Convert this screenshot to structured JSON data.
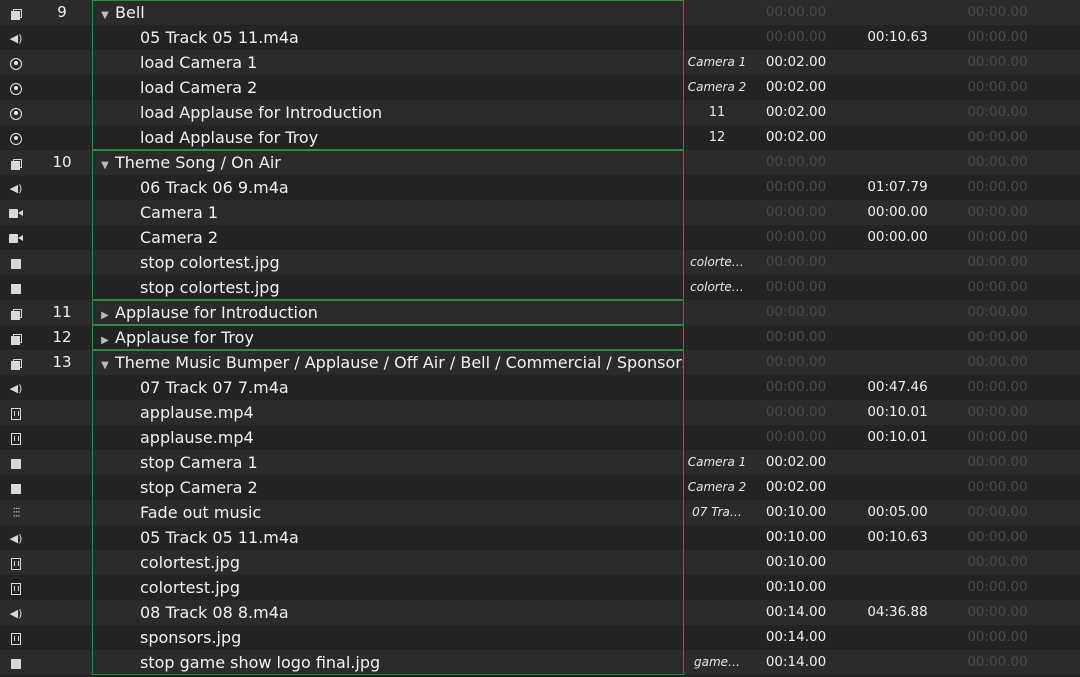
{
  "rows": [
    {
      "icon": "group",
      "icon_name": "group-cue-icon",
      "num": "9",
      "name": "Bell",
      "kind": "group",
      "expand": "open",
      "target": "",
      "pre": "00:00.00",
      "pre_lit": false,
      "dur": "",
      "dur_lit": false,
      "post": "00:00.00",
      "post_lit": false
    },
    {
      "icon": "audio",
      "icon_name": "audio-cue-icon",
      "num": "",
      "name": "05 Track 05 11.m4a",
      "kind": "child",
      "target": "",
      "pre": "00:00.00",
      "pre_lit": false,
      "dur": "00:10.63",
      "dur_lit": true,
      "post": "00:00.00",
      "post_lit": false
    },
    {
      "icon": "target",
      "icon_name": "load-cue-icon",
      "num": "",
      "name": "load Camera 1",
      "kind": "child",
      "target": "Camera 1",
      "pre": "00:02.00",
      "pre_lit": true,
      "dur": "",
      "dur_lit": false,
      "post": "00:00.00",
      "post_lit": false
    },
    {
      "icon": "target",
      "icon_name": "load-cue-icon",
      "num": "",
      "name": "load Camera 2",
      "kind": "child",
      "target": "Camera 2",
      "pre": "00:02.00",
      "pre_lit": true,
      "dur": "",
      "dur_lit": false,
      "post": "00:00.00",
      "post_lit": false
    },
    {
      "icon": "target",
      "icon_name": "load-cue-icon",
      "num": "",
      "name": "load Applause for Introduction",
      "kind": "child",
      "target": "11",
      "target_num": true,
      "pre": "00:02.00",
      "pre_lit": true,
      "dur": "",
      "dur_lit": false,
      "post": "00:00.00",
      "post_lit": false
    },
    {
      "icon": "target",
      "icon_name": "load-cue-icon",
      "num": "",
      "name": "load Applause for Troy",
      "kind": "child",
      "target": "12",
      "target_num": true,
      "pre": "00:02.00",
      "pre_lit": true,
      "dur": "",
      "dur_lit": false,
      "post": "00:00.00",
      "post_lit": false
    },
    {
      "icon": "group",
      "icon_name": "group-cue-icon",
      "num": "10",
      "name": "Theme Song / On Air",
      "kind": "group",
      "expand": "open",
      "target": "",
      "pre": "00:00.00",
      "pre_lit": false,
      "dur": "",
      "dur_lit": false,
      "post": "00:00.00",
      "post_lit": false
    },
    {
      "icon": "audio",
      "icon_name": "audio-cue-icon",
      "num": "",
      "name": "06 Track 06 9.m4a",
      "kind": "child",
      "target": "",
      "pre": "00:00.00",
      "pre_lit": false,
      "dur": "01:07.79",
      "dur_lit": true,
      "post": "00:00.00",
      "post_lit": false
    },
    {
      "icon": "camera",
      "icon_name": "camera-cue-icon",
      "num": "",
      "name": "Camera 1",
      "kind": "child",
      "target": "",
      "pre": "00:00.00",
      "pre_lit": false,
      "dur": "00:00.00",
      "dur_lit": true,
      "post": "00:00.00",
      "post_lit": false
    },
    {
      "icon": "camera",
      "icon_name": "camera-cue-icon",
      "num": "",
      "name": "Camera 2",
      "kind": "child",
      "target": "",
      "pre": "00:00.00",
      "pre_lit": false,
      "dur": "00:00.00",
      "dur_lit": true,
      "post": "00:00.00",
      "post_lit": false
    },
    {
      "icon": "stop",
      "icon_name": "stop-cue-icon",
      "num": "",
      "name": "stop colortest.jpg",
      "kind": "child",
      "target": "colorte…",
      "pre": "00:00.00",
      "pre_lit": false,
      "dur": "",
      "dur_lit": false,
      "post": "00:00.00",
      "post_lit": false
    },
    {
      "icon": "stop",
      "icon_name": "stop-cue-icon",
      "num": "",
      "name": "stop colortest.jpg",
      "kind": "child",
      "target": "colorte…",
      "pre": "00:00.00",
      "pre_lit": false,
      "dur": "",
      "dur_lit": false,
      "post": "00:00.00",
      "post_lit": false
    },
    {
      "icon": "group",
      "icon_name": "group-cue-icon",
      "num": "11",
      "name": "Applause for Introduction",
      "kind": "group",
      "expand": "closed",
      "target": "",
      "pre": "00:00.00",
      "pre_lit": false,
      "dur": "",
      "dur_lit": false,
      "post": "00:00.00",
      "post_lit": false
    },
    {
      "icon": "group",
      "icon_name": "group-cue-icon",
      "num": "12",
      "name": "Applause for Troy",
      "kind": "group",
      "expand": "closed",
      "target": "",
      "pre": "00:00.00",
      "pre_lit": false,
      "dur": "",
      "dur_lit": false,
      "post": "00:00.00",
      "post_lit": false
    },
    {
      "icon": "group",
      "icon_name": "group-cue-icon",
      "num": "13",
      "name": "Theme Music Bumper / Applause / Off Air / Bell / Commercial / Sponsors",
      "kind": "group",
      "expand": "open",
      "target": "",
      "pre": "00:00.00",
      "pre_lit": false,
      "dur": "",
      "dur_lit": false,
      "post": "00:00.00",
      "post_lit": false
    },
    {
      "icon": "audio",
      "icon_name": "audio-cue-icon",
      "num": "",
      "name": "07 Track 07 7.m4a",
      "kind": "child",
      "target": "",
      "pre": "00:00.00",
      "pre_lit": false,
      "dur": "00:47.46",
      "dur_lit": true,
      "post": "00:00.00",
      "post_lit": false
    },
    {
      "icon": "film",
      "icon_name": "video-cue-icon",
      "num": "",
      "name": "applause.mp4",
      "kind": "child",
      "target": "",
      "pre": "00:00.00",
      "pre_lit": false,
      "dur": "00:10.01",
      "dur_lit": true,
      "post": "00:00.00",
      "post_lit": false
    },
    {
      "icon": "film",
      "icon_name": "video-cue-icon",
      "num": "",
      "name": "applause.mp4",
      "kind": "child",
      "target": "",
      "pre": "00:00.00",
      "pre_lit": false,
      "dur": "00:10.01",
      "dur_lit": true,
      "post": "00:00.00",
      "post_lit": false
    },
    {
      "icon": "stop",
      "icon_name": "stop-cue-icon",
      "num": "",
      "name": "stop Camera 1",
      "kind": "child",
      "target": "Camera 1",
      "pre": "00:02.00",
      "pre_lit": true,
      "dur": "",
      "dur_lit": false,
      "post": "00:00.00",
      "post_lit": false
    },
    {
      "icon": "stop",
      "icon_name": "stop-cue-icon",
      "num": "",
      "name": "stop Camera 2",
      "kind": "child",
      "target": "Camera 2",
      "pre": "00:02.00",
      "pre_lit": true,
      "dur": "",
      "dur_lit": false,
      "post": "00:00.00",
      "post_lit": false
    },
    {
      "icon": "fade",
      "icon_name": "fade-cue-icon",
      "num": "",
      "name": "Fade out music",
      "kind": "child",
      "target": "07 Tra…",
      "pre": "00:10.00",
      "pre_lit": true,
      "dur": "00:05.00",
      "dur_lit": true,
      "post": "00:00.00",
      "post_lit": false
    },
    {
      "icon": "audio",
      "icon_name": "audio-cue-icon",
      "num": "",
      "name": "05 Track 05 11.m4a",
      "kind": "child",
      "target": "",
      "pre": "00:10.00",
      "pre_lit": true,
      "dur": "00:10.63",
      "dur_lit": true,
      "post": "00:00.00",
      "post_lit": false
    },
    {
      "icon": "film",
      "icon_name": "video-cue-icon",
      "num": "",
      "name": "colortest.jpg",
      "kind": "child",
      "target": "",
      "pre": "00:10.00",
      "pre_lit": true,
      "dur": "",
      "dur_lit": false,
      "post": "00:00.00",
      "post_lit": false
    },
    {
      "icon": "film",
      "icon_name": "video-cue-icon",
      "num": "",
      "name": "colortest.jpg",
      "kind": "child",
      "target": "",
      "pre": "00:10.00",
      "pre_lit": true,
      "dur": "",
      "dur_lit": false,
      "post": "00:00.00",
      "post_lit": false
    },
    {
      "icon": "audio",
      "icon_name": "audio-cue-icon",
      "num": "",
      "name": "08 Track 08 8.m4a",
      "kind": "child",
      "target": "",
      "pre": "00:14.00",
      "pre_lit": true,
      "dur": "04:36.88",
      "dur_lit": true,
      "post": "00:00.00",
      "post_lit": false
    },
    {
      "icon": "film",
      "icon_name": "video-cue-icon",
      "num": "",
      "name": "sponsors.jpg",
      "kind": "child",
      "target": "",
      "pre": "00:14.00",
      "pre_lit": true,
      "dur": "",
      "dur_lit": false,
      "post": "00:00.00",
      "post_lit": false
    },
    {
      "icon": "stop",
      "icon_name": "stop-cue-icon",
      "num": "",
      "name": "stop game show logo final.jpg",
      "kind": "child",
      "target": "game…",
      "pre": "00:14.00",
      "pre_lit": true,
      "dur": "",
      "dur_lit": false,
      "post": "00:00.00",
      "post_lit": false
    }
  ],
  "colors": {
    "group_border": "#2f8a3c",
    "row_odd": "#2b2b2b",
    "row_even": "#232323",
    "time_dim": "#4a4a4a",
    "time_lit": "#f0f0f0"
  }
}
